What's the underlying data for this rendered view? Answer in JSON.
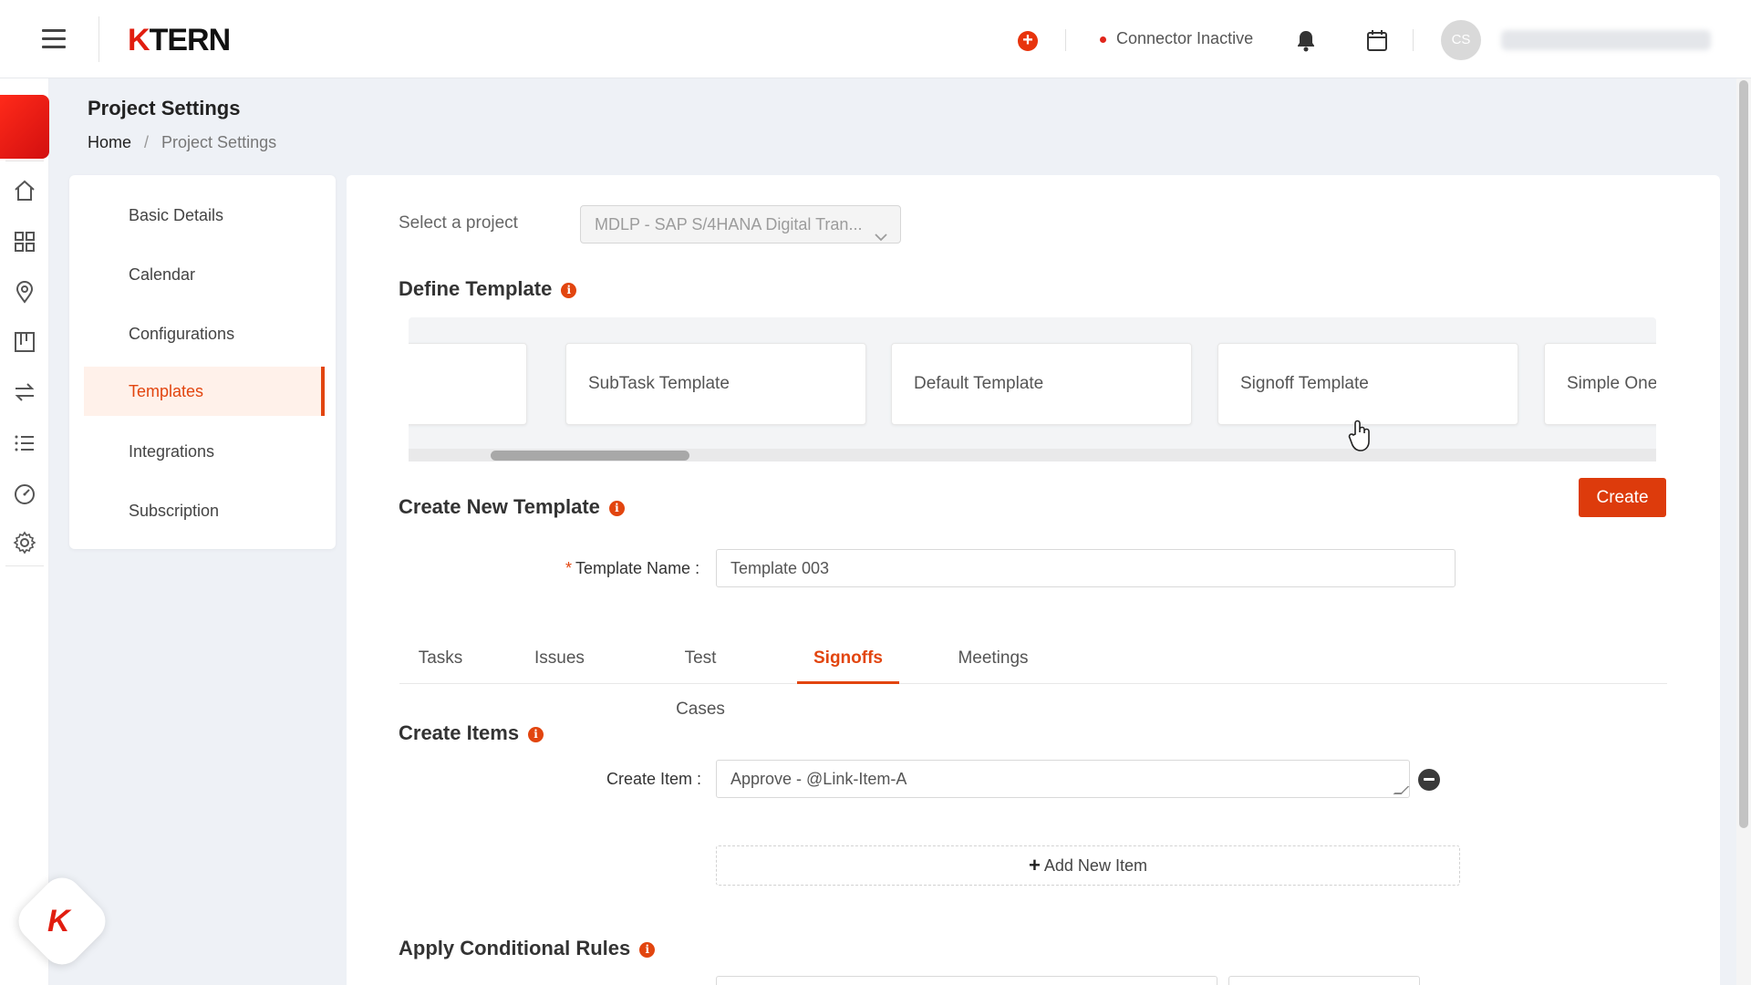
{
  "header": {
    "logo_k": "K",
    "logo_rest": "TERN",
    "connector_status": "Connector Inactive",
    "avatar_initials": "CS",
    "icons": [
      "menu-icon",
      "add-circle-icon",
      "bell-icon",
      "calendar-icon"
    ],
    "accent_color": "#dd3b0c"
  },
  "rail": {
    "icons": [
      "home-icon",
      "grid-icon",
      "location-pin-icon",
      "board-icon",
      "swap-arrows-icon",
      "list-icon",
      "dashboard-gauge-icon",
      "gear-icon"
    ]
  },
  "page": {
    "title": "Project Settings",
    "breadcrumb": {
      "home": "Home",
      "separator": "/",
      "current": "Project Settings"
    }
  },
  "settings_menu": {
    "items": [
      {
        "label": "Basic Details"
      },
      {
        "label": "Calendar"
      },
      {
        "label": "Configurations"
      },
      {
        "label": "Templates",
        "active": true
      },
      {
        "label": "Integrations"
      },
      {
        "label": "Subscription"
      }
    ]
  },
  "main": {
    "project_label": "Select a project",
    "project_value": "MDLP - SAP S/4HANA Digital Tran...",
    "define_template_title": "Define Template",
    "template_cards": [
      "",
      "SubTask Template",
      "Default Template",
      "Signoff Template",
      "Simple One"
    ],
    "create_button": "Create",
    "create_new_title": "Create New Template",
    "template_name_required": "*",
    "template_name_label": "Template Name",
    "template_name_value": "Template 003",
    "tabs": [
      {
        "label": "Tasks"
      },
      {
        "label": "Issues"
      },
      {
        "label": "Test Cases"
      },
      {
        "label": "Signoffs",
        "active": true
      },
      {
        "label": "Meetings"
      }
    ],
    "create_items_title": "Create Items",
    "create_item_label": "Create Item",
    "create_item_value": "Approve - @Link-Item-A",
    "add_new_item": "Add New Item",
    "conditional_rules_title": "Apply Conditional Rules",
    "info_glyph": "i"
  }
}
